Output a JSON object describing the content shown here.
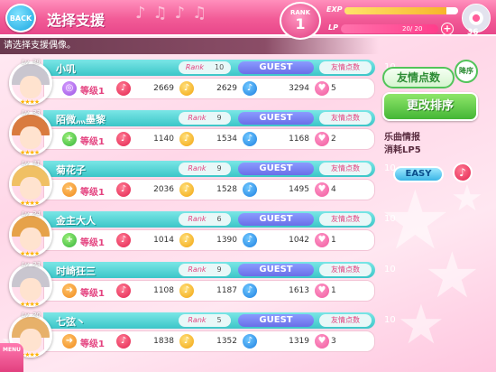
{
  "header": {
    "back_label": "BACK",
    "title": "选择支援",
    "rank_label": "RANK",
    "rank_value": "1",
    "exp_label": "EXP",
    "exp_fraction": 0.9,
    "lp_label": "LP",
    "lp_text": "20/ 20",
    "lp_fraction": 1.0,
    "lp_plus": "+",
    "disc_count": "36"
  },
  "subtitle": "请选择支援偶像。",
  "rows": [
    {
      "level": "Lv. 39",
      "name": "小叽",
      "rank_label": "Rank",
      "rank": "10",
      "guest": "GUEST",
      "friend_label": "友情点数",
      "friend_points": "10",
      "lvl_label": "等级1",
      "attr_icon": "music-note-icon",
      "v1": "2669",
      "v2": "2629",
      "v3": "3294",
      "skill": "5",
      "lvl_icon": "purple-circle-icon",
      "hair": "#c9c6cf"
    },
    {
      "level": "Lv. 33",
      "name": "陌微灬墨黎",
      "rank_label": "Rank",
      "rank": "9",
      "guest": "GUEST",
      "friend_label": "友情点数",
      "friend_points": "10",
      "lvl_label": "等级1",
      "attr_icon": "music-note-icon",
      "v1": "1140",
      "v2": "1534",
      "v3": "1168",
      "skill": "2",
      "lvl_icon": "green-plus-icon",
      "hair": "#d97b3f"
    },
    {
      "level": "Lv. 31",
      "name": "菊花子",
      "rank_label": "Rank",
      "rank": "9",
      "guest": "GUEST",
      "friend_label": "友情点数",
      "friend_points": "10",
      "lvl_label": "等级1",
      "attr_icon": "music-note-icon",
      "v1": "2036",
      "v2": "1528",
      "v3": "1495",
      "skill": "4",
      "lvl_icon": "orange-arrow-icon",
      "hair": "#f0c064"
    },
    {
      "level": "Lv. 24",
      "name": "金主大人",
      "rank_label": "Rank",
      "rank": "6",
      "guest": "GUEST",
      "friend_label": "友情点数",
      "friend_points": "10",
      "lvl_label": "等级1",
      "attr_icon": "music-note-icon",
      "v1": "1014",
      "v2": "1390",
      "v3": "1042",
      "skill": "1",
      "lvl_icon": "green-plus-icon",
      "hair": "#e6a24a"
    },
    {
      "level": "Lv. 23",
      "name": "时崎狂三",
      "rank_label": "Rank",
      "rank": "9",
      "guest": "GUEST",
      "friend_label": "友情点数",
      "friend_points": "10",
      "lvl_label": "等级1",
      "attr_icon": "music-note-icon",
      "v1": "1108",
      "v2": "1187",
      "v3": "1613",
      "skill": "1",
      "lvl_icon": "orange-arrow-icon",
      "hair": "#c9c6cf"
    },
    {
      "level": "Lv. 20",
      "name": "七弦丶",
      "rank_label": "Rank",
      "rank": "5",
      "guest": "GUEST",
      "friend_label": "友情点数",
      "friend_points": "10",
      "lvl_label": "等级1",
      "attr_icon": "music-note-icon",
      "v1": "1838",
      "v2": "1352",
      "v3": "1319",
      "skill": "3",
      "lvl_icon": "orange-arrow-icon",
      "hair": "#e7b16a"
    }
  ],
  "panel": {
    "friend_points_button": "友情点数",
    "order_badge": "降序",
    "sort_button": "更改排序",
    "song_info_title": "乐曲情报",
    "song_info_cost": "消耗LP5",
    "difficulty": "EASY"
  },
  "menu_label": "MENU"
}
